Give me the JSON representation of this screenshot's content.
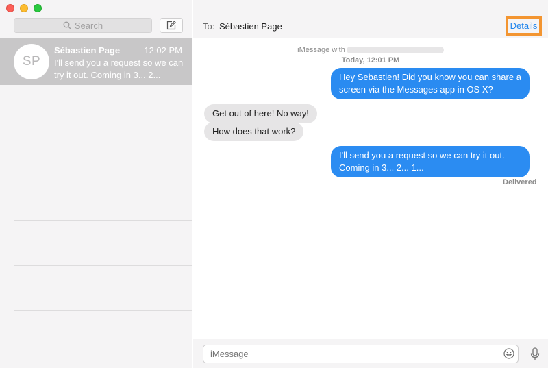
{
  "sidebar": {
    "search_placeholder": "Search",
    "conversation": {
      "initials": "SP",
      "name": "Sébastien Page",
      "time": "12:02 PM",
      "preview": "I'll send you a request so we can try it out. Coming in 3... 2..."
    }
  },
  "header": {
    "to_label": "To:",
    "recipient": "Sébastien Page",
    "details_label": "Details"
  },
  "thread": {
    "imessage_with": "iMessage with",
    "timestamp": "Today, 12:01 PM",
    "messages": [
      {
        "direction": "outgoing",
        "text": "Hey Sebastien! Did you know you can share a screen via the Messages app in OS X?"
      },
      {
        "direction": "incoming",
        "text": "Get out of here! No way!"
      },
      {
        "direction": "incoming",
        "text": "How does that work?"
      },
      {
        "direction": "outgoing",
        "text": "I'll send you a request so we can try it out. Coming in 3... 2... 1..."
      }
    ],
    "status": "Delivered"
  },
  "footer": {
    "input_placeholder": "iMessage"
  },
  "colors": {
    "outgoing_bubble": "#2b8cf2",
    "incoming_bubble": "#e6e5e6",
    "highlight": "#f39531",
    "link": "#1f84ec"
  }
}
